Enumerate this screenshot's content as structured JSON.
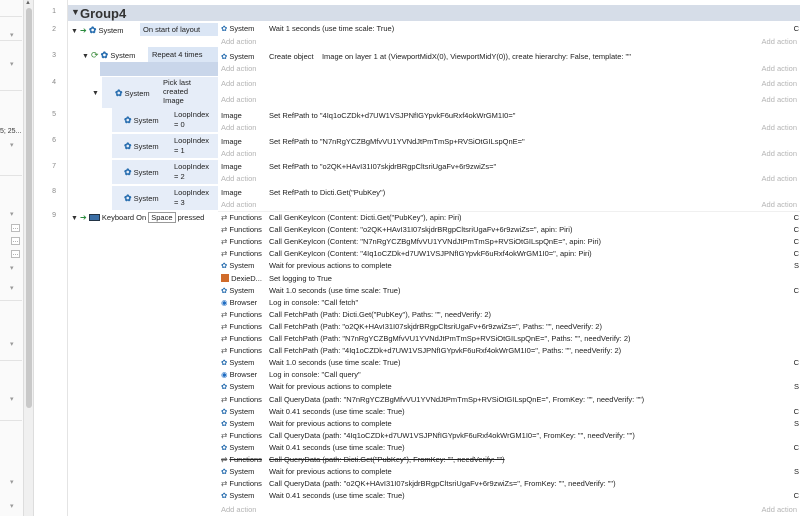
{
  "group": {
    "title": "Group4"
  },
  "line_numbers": [
    "1",
    "2",
    "3",
    "4",
    "5",
    "6",
    "7",
    "8",
    "9"
  ],
  "left_panel": {
    "snippet": "5; 25..."
  },
  "events": [
    {
      "num": "2",
      "object": "System",
      "condition": "On start of layout"
    },
    {
      "num": "3",
      "object": "System",
      "condition": "Repeat 4 times"
    },
    {
      "num": "4",
      "object": "System",
      "condition_l1": "Pick last",
      "condition_l2": "created",
      "condition_l3": "Image"
    },
    {
      "num": "5",
      "object": "System",
      "condition_l1": "LoopIndex",
      "condition_l2": "= 0"
    },
    {
      "num": "6",
      "object": "System",
      "condition_l1": "LoopIndex",
      "condition_l2": "= 1"
    },
    {
      "num": "7",
      "object": "System",
      "condition_l1": "LoopIndex",
      "condition_l2": "= 2"
    },
    {
      "num": "8",
      "object": "System",
      "condition_l1": "LoopIndex",
      "condition_l2": "= 3"
    },
    {
      "num": "9",
      "object": "Keyboard",
      "condition_pre": "On",
      "condition_key": "Space",
      "condition_post": "pressed"
    }
  ],
  "add_action": "Add action",
  "actions_top": [
    {
      "object": "System",
      "text": "Wait 1 seconds (use time scale: True)",
      "right": "C"
    },
    {
      "object": "System",
      "text": "Create object    Image on layer 1 at (ViewportMidX(0), ViewportMidY(0)), create hierarchy: False, template: \"\"",
      "right": ""
    },
    {
      "object": "Image",
      "text": "Set RefPath to \"4Iq1oCZDk+d7UW1VSJPNfIGYpvkF6uRxf4okWrGM1I0=\"",
      "right": ""
    },
    {
      "object": "Image",
      "text": "Set RefPath to \"N7nRgYCZBgMfvVU1YVNdJtPmTmSp+RVSiOtGILspQnE=\"",
      "right": ""
    },
    {
      "object": "Image",
      "text": "Set RefPath to \"o2QK+HAvI31I07skjdrBRgpCltsriUgaFv+6r9zwiZs=\"",
      "right": ""
    },
    {
      "object": "Image",
      "text": "Set RefPath to Dicti.Get(\"PubKey\")",
      "right": ""
    }
  ],
  "keyboard_actions": [
    {
      "object": "Functions",
      "text": "Call GenKeyIcon (Content: Dicti.Get(\"PubKey\"), apin: Piri)",
      "right": "C"
    },
    {
      "object": "Functions",
      "text": "Call GenKeyIcon (Content: \"o2QK+HAvI31I07skjdrBRgpCltsriUgaFv+6r9zwiZs=\", apin: Piri)",
      "right": "C"
    },
    {
      "object": "Functions",
      "text": "Call GenKeyIcon (Content: \"N7nRgYCZBgMfvVU1YVNdJtPmTmSp+RVSiOtGILspQnE=\", apin: Piri)",
      "right": "C"
    },
    {
      "object": "Functions",
      "text": "Call GenKeyIcon (Content: \"4Iq1oCZDk+d7UW1VSJPNfIGYpvkF6uRxf4okWrGM1I0=\", apin: Piri)",
      "right": "C"
    },
    {
      "object": "System",
      "text": "Wait for previous actions to complete",
      "right": "S"
    },
    {
      "object": "DexieD...",
      "text": "Set logging to True",
      "right": ""
    },
    {
      "object": "System",
      "text": "Wait 1.0 seconds (use time scale: True)",
      "right": "C"
    },
    {
      "object": "Browser",
      "text": "Log in console: \"Call fetch\"",
      "right": ""
    },
    {
      "object": "Functions",
      "text": "Call FetchPath (Path: Dicti.Get(\"PubKey\"), Paths: \"\", needVerify: 2)",
      "right": ""
    },
    {
      "object": "Functions",
      "text": "Call FetchPath (Path: \"o2QK+HAvI31I07skjdrBRgpCltsriUgaFv+6r9zwiZs=\", Paths: \"\", needVerify: 2)",
      "right": ""
    },
    {
      "object": "Functions",
      "text": "Call FetchPath (Path: \"N7nRgYCZBgMfvVU1YVNdJtPmTmSp+RVSiOtGILspQnE=\", Paths: \"\", needVerify: 2)",
      "right": ""
    },
    {
      "object": "Functions",
      "text": "Call FetchPath (Path: \"4Iq1oCZDk+d7UW1VSJPNfIGYpvkF6uRxf4okWrGM1I0=\", Paths: \"\", needVerify: 2)",
      "right": ""
    },
    {
      "object": "System",
      "text": "Wait 1.0 seconds (use time scale: True)",
      "right": "C"
    },
    {
      "object": "Browser",
      "text": "Log in console: \"Call query\"",
      "right": ""
    },
    {
      "object": "System",
      "text": "Wait for previous actions to complete",
      "right": "S"
    },
    {
      "object": "Functions",
      "text": "Call QueryData (path: \"N7nRgYCZBgMfvVU1YVNdJtPmTmSp+RVSiOtGILspQnE=\", FromKey: \"\", needVerify: \"\")",
      "right": ""
    },
    {
      "object": "System",
      "text": "Wait 0.41 seconds (use time scale: True)",
      "right": "C"
    },
    {
      "object": "System",
      "text": "Wait for previous actions to complete",
      "right": "S"
    },
    {
      "object": "Functions",
      "text": "Call QueryData (path: \"4Iq1oCZDk+d7UW1VSJPNfIGYpvkF6uRxf4okWrGM1I0=\", FromKey: \"\", needVerify: \"\")",
      "right": ""
    },
    {
      "object": "System",
      "text": "Wait 0.41 seconds (use time scale: True)",
      "right": "C"
    },
    {
      "object": "Functions",
      "text": "Call QueryData (path: Dicti.Get(\"PubKey\"), FromKey: \"\", needVerify: \"\")",
      "right": "",
      "struck": true
    },
    {
      "object": "System",
      "text": "Wait for previous actions to complete",
      "right": "S"
    },
    {
      "object": "Functions",
      "text": "Call QueryData (path: \"o2QK+HAvI31I07skjdrBRgpCltsriUgaFv+6r9zwiZs=\", FromKey: \"\", needVerify: \"\")",
      "right": ""
    },
    {
      "object": "System",
      "text": "Wait 0.41 seconds (use time scale: True)",
      "right": "C"
    }
  ]
}
